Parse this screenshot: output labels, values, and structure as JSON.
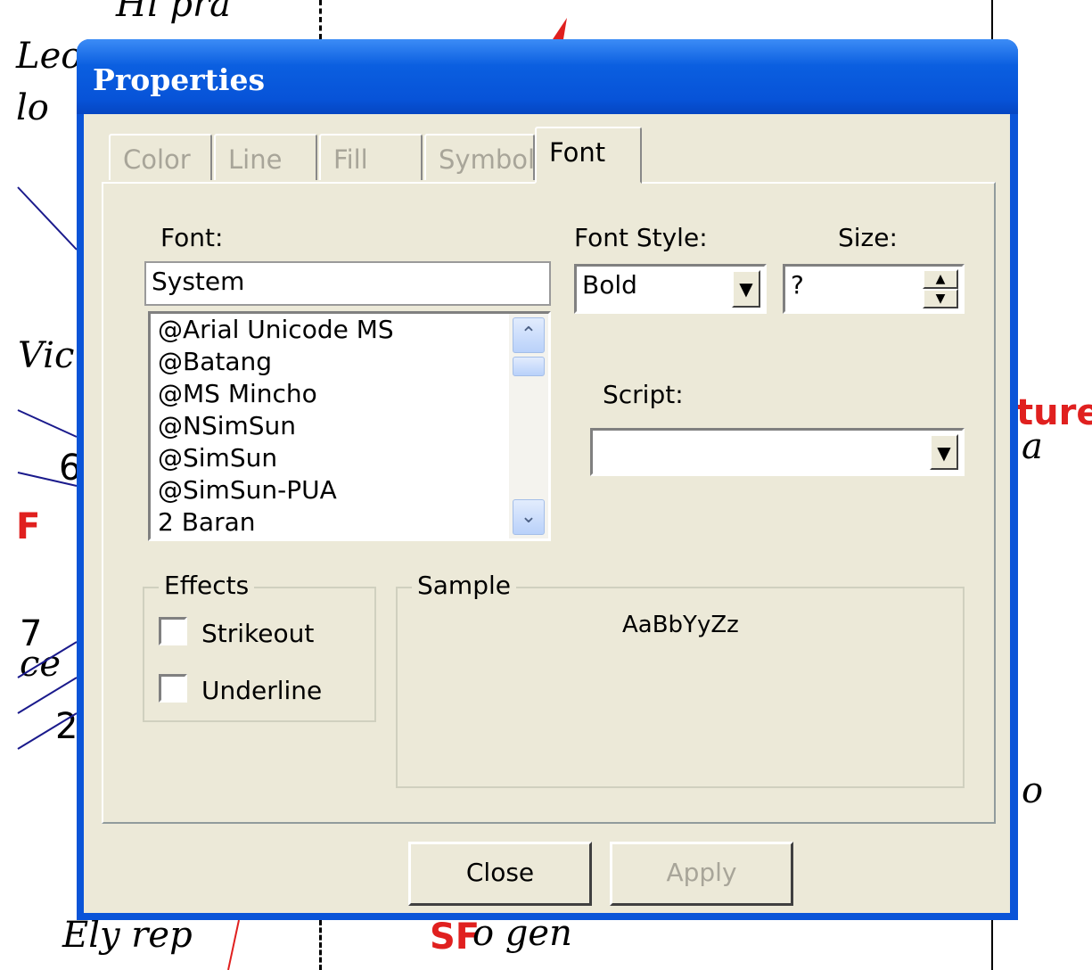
{
  "background": {
    "fragments": [
      "Hi pra",
      "Leo",
      "lo",
      "Vic",
      "6",
      "F",
      "7",
      "ce",
      "2",
      "ture",
      "a",
      "o",
      "Ely rep",
      "SF",
      "o gen"
    ]
  },
  "window": {
    "title": "Properties",
    "tabs": [
      {
        "label": "Color",
        "active": false
      },
      {
        "label": "Line",
        "active": false
      },
      {
        "label": "Fill",
        "active": false
      },
      {
        "label": "Symbol",
        "active": false
      },
      {
        "label": "Font",
        "active": true
      }
    ],
    "font": {
      "label": "Font:",
      "value": "System",
      "list": [
        "@Arial Unicode MS",
        "@Batang",
        "@MS Mincho",
        "@NSimSun",
        "@SimSun",
        "@SimSun-PUA",
        "2  Baran"
      ]
    },
    "font_style": {
      "label": "Font Style:",
      "value": "Bold"
    },
    "size": {
      "label": "Size:",
      "value": "?"
    },
    "script": {
      "label": "Script:",
      "value": ""
    },
    "effects": {
      "label": "Effects",
      "strikeout": {
        "label": "Strikeout",
        "checked": false
      },
      "underline": {
        "label": "Underline",
        "checked": false
      }
    },
    "sample": {
      "label": "Sample",
      "text": "AaBbYyZz"
    },
    "buttons": {
      "close": "Close",
      "apply": "Apply"
    }
  },
  "colors": {
    "titlebar": "#0753d8",
    "face": "#ece9d8",
    "disabled_text": "#a8a599"
  }
}
